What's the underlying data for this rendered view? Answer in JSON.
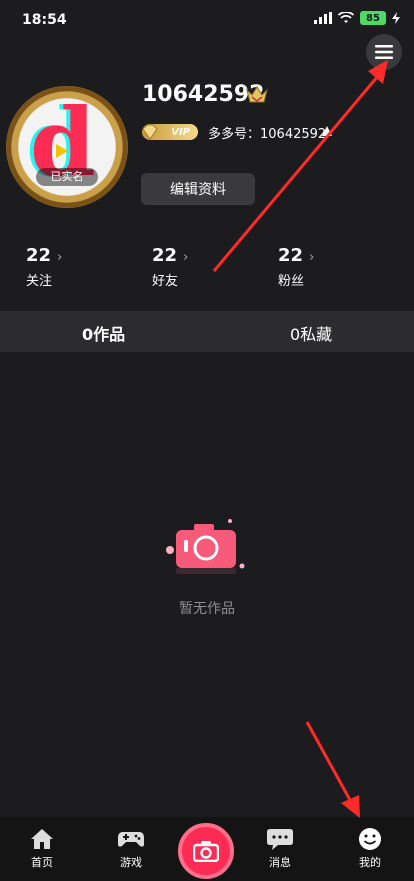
{
  "status_bar": {
    "time": "18:54",
    "battery": "85"
  },
  "profile": {
    "username": "10642592",
    "avatar_letter": "d",
    "avatar_label": "已实名",
    "vip_label": "VIP",
    "account_id": "多多号：10642592",
    "edit_button": "编辑资料"
  },
  "stats": [
    {
      "count": "22",
      "label": "关注"
    },
    {
      "count": "22",
      "label": "好友"
    },
    {
      "count": "22",
      "label": "粉丝"
    }
  ],
  "tabs": [
    {
      "label": "0作品",
      "active": true
    },
    {
      "label": "0私藏",
      "active": false
    }
  ],
  "empty_state": {
    "text": "暂无作品"
  },
  "bottom_nav": {
    "items": [
      {
        "label": "首页",
        "icon": "home-icon"
      },
      {
        "label": "游戏",
        "icon": "gamepad-icon"
      },
      {
        "label": "",
        "icon": "camera-icon"
      },
      {
        "label": "消息",
        "icon": "message-icon"
      },
      {
        "label": "我的",
        "icon": "smiley-icon"
      }
    ]
  },
  "colors": {
    "accent": "#fe2c55",
    "background": "#1c1c1e",
    "tab_bar": "#2c2c2e",
    "vip_gold": "#e6c265"
  }
}
